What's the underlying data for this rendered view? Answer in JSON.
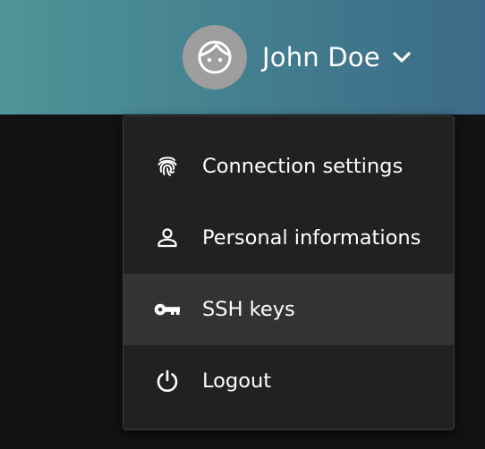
{
  "header": {
    "user_name": "John Doe",
    "avatar_icon": "face-icon",
    "dropdown_icon": "chevron-down-icon"
  },
  "menu": {
    "items": [
      {
        "label": "Connection settings",
        "icon": "fingerprint-icon",
        "active": false
      },
      {
        "label": "Personal informations",
        "icon": "person-icon",
        "active": false
      },
      {
        "label": "SSH keys",
        "icon": "key-icon",
        "active": true
      },
      {
        "label": "Logout",
        "icon": "power-icon",
        "active": false
      }
    ]
  },
  "colors": {
    "header_gradient_start": "#4e9598",
    "header_gradient_end": "#3b6b88",
    "menu_background": "#212121",
    "menu_item_active": "#333333",
    "page_background": "#121212",
    "avatar_background": "#9e9e9e"
  }
}
